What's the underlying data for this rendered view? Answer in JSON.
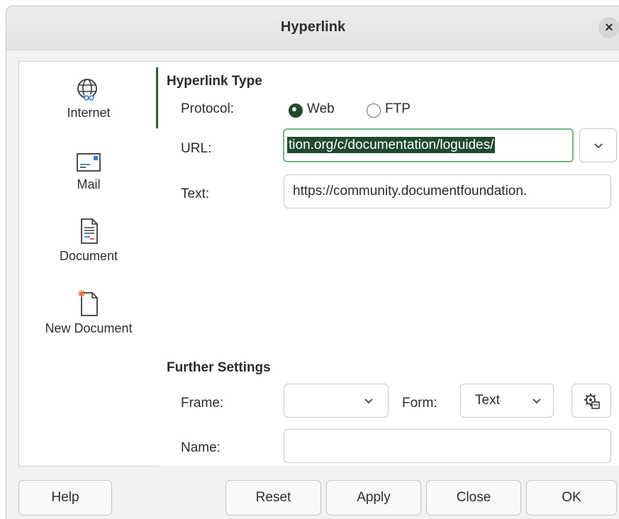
{
  "dialog": {
    "title": "Hyperlink",
    "close_glyph": "×"
  },
  "sidebar": {
    "items": [
      {
        "label": "Internet",
        "icon": "globe-link-icon",
        "active": true
      },
      {
        "label": "Mail",
        "icon": "envelope-icon"
      },
      {
        "label": "Document",
        "icon": "document-icon"
      },
      {
        "label": "New Document",
        "icon": "new-document-icon"
      }
    ]
  },
  "hyperlink_type": {
    "heading": "Hyperlink Type",
    "protocol_label": "Protocol:",
    "protocol_options": [
      {
        "label": "Web",
        "selected": true
      },
      {
        "label": "FTP",
        "selected": false
      }
    ],
    "url_label": "URL:",
    "url_value": "tion.org/c/documentation/loguides/",
    "text_label": "Text:",
    "text_value": "https://community.documentfoundation."
  },
  "further_settings": {
    "heading": "Further Settings",
    "frame_label": "Frame:",
    "frame_value": "",
    "form_label": "Form:",
    "form_value": "Text",
    "name_label": "Name:",
    "name_value": ""
  },
  "buttons": {
    "help": "Help",
    "reset": "Reset",
    "apply": "Apply",
    "close": "Close",
    "ok": "OK"
  },
  "colors": {
    "accent": "#1f4a2e",
    "focus_border": "#6fb88a"
  }
}
